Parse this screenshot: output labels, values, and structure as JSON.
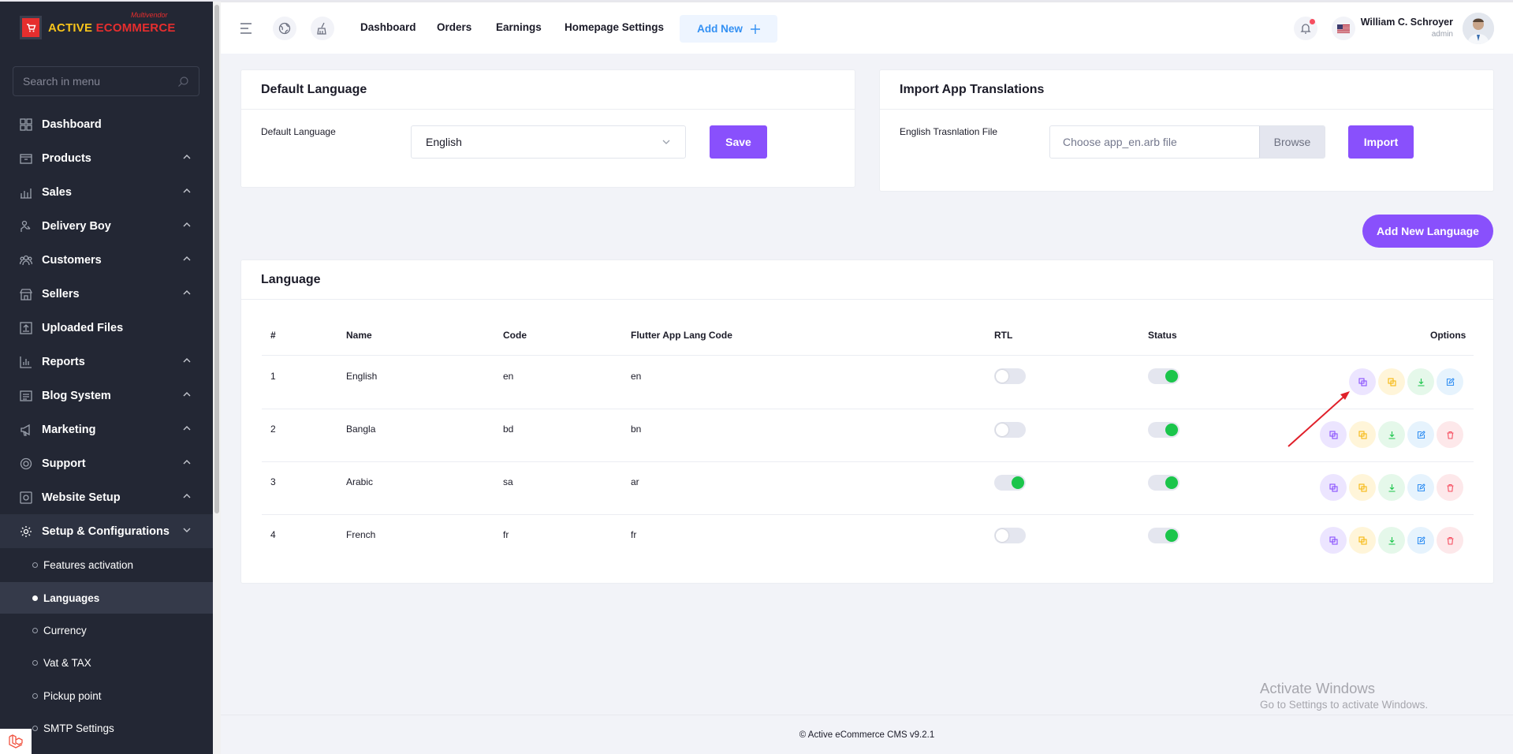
{
  "brand": {
    "name_part1": "ACTIVE",
    "name_part2": "ECOMMERCE",
    "tag": "Multivendor",
    "logo_color": "#e62e2e"
  },
  "sidebar": {
    "search_placeholder": "Search in menu",
    "items": [
      {
        "label": "Dashboard",
        "icon": "dashboard-icon"
      },
      {
        "label": "Products",
        "icon": "box-icon"
      },
      {
        "label": "Sales",
        "icon": "chart-icon"
      },
      {
        "label": "Delivery Boy",
        "icon": "delivery-icon"
      },
      {
        "label": "Customers",
        "icon": "users-icon"
      },
      {
        "label": "Sellers",
        "icon": "store-icon"
      },
      {
        "label": "Uploaded Files",
        "icon": "upload-icon"
      },
      {
        "label": "Reports",
        "icon": "report-icon"
      },
      {
        "label": "Blog System",
        "icon": "blog-icon"
      },
      {
        "label": "Marketing",
        "icon": "megaphone-icon"
      },
      {
        "label": "Support",
        "icon": "support-icon"
      },
      {
        "label": "Website Setup",
        "icon": "desktop-icon"
      },
      {
        "label": "Setup & Configurations",
        "icon": "gear-icon"
      }
    ],
    "subitems": [
      {
        "label": "Features activation"
      },
      {
        "label": "Languages"
      },
      {
        "label": "Currency"
      },
      {
        "label": "Vat & TAX"
      },
      {
        "label": "Pickup point"
      },
      {
        "label": "SMTP Settings"
      }
    ]
  },
  "header": {
    "nav": [
      "Dashboard",
      "Orders",
      "Earnings",
      "Homepage Settings"
    ],
    "add_new": "Add New",
    "user_name": "William C. Schroyer",
    "user_role": "admin"
  },
  "default_language": {
    "title": "Default Language",
    "label": "Default Language",
    "selected": "English",
    "save": "Save"
  },
  "import_translations": {
    "title": "Import App Translations",
    "label": "English Trasnlation File",
    "placeholder": "Choose app_en.arb file",
    "browse": "Browse",
    "import": "Import"
  },
  "add_language": "Add New Language",
  "language_table": {
    "title": "Language",
    "headers": {
      "num": "#",
      "name": "Name",
      "code": "Code",
      "flutter": "Flutter App Lang Code",
      "rtl": "RTL",
      "status": "Status",
      "options": "Options"
    },
    "rows": [
      {
        "num": "1",
        "name": "English",
        "code": "en",
        "flutter": "en",
        "rtl": false,
        "status": true
      },
      {
        "num": "2",
        "name": "Bangla",
        "code": "bd",
        "flutter": "bn",
        "rtl": false,
        "status": true
      },
      {
        "num": "3",
        "name": "Arabic",
        "code": "sa",
        "flutter": "ar",
        "rtl": true,
        "status": true
      },
      {
        "num": "4",
        "name": "French",
        "code": "fr",
        "flutter": "fr",
        "rtl": false,
        "status": true
      }
    ]
  },
  "footer": "© Active eCommerce CMS v9.2.1",
  "watermark": {
    "line1": "Activate Windows",
    "line2": "Go to Settings to activate Windows."
  },
  "colors": {
    "accent": "#8950fc",
    "sidebar": "#232734",
    "success": "#1bc54b",
    "danger": "#f64e60"
  }
}
